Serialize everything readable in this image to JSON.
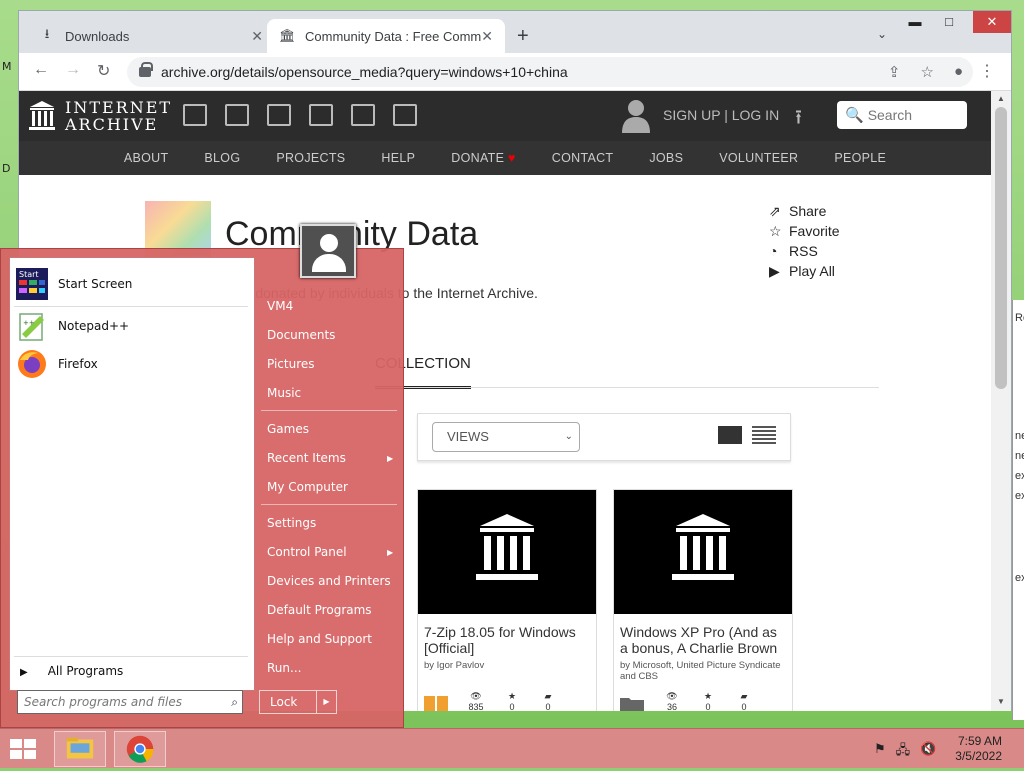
{
  "browser": {
    "tabs": [
      {
        "label": "Downloads",
        "icon": "download-icon",
        "active": false
      },
      {
        "label": "Community Data : Free Commun",
        "icon": "archive-icon",
        "active": true
      }
    ],
    "url": "archive.org/details/opensource_media?query=windows+10+china"
  },
  "ia": {
    "logo_line1": "INTERNET",
    "logo_line2": "ARCHIVE",
    "signup": "SIGN UP | LOG IN",
    "search_placeholder": "Search",
    "nav": [
      "ABOUT",
      "BLOG",
      "PROJECTS",
      "HELP",
      "DONATE",
      "CONTACT",
      "JOBS",
      "VOLUNTEER",
      "PEOPLE"
    ]
  },
  "collection": {
    "title": "Community Data",
    "description": "edia donated by individuals to the Internet Archive.",
    "actions": [
      "Share",
      "Favorite",
      "RSS",
      "Play All"
    ],
    "tab": "COLLECTION",
    "views_label": "VIEWS"
  },
  "cards": [
    {
      "title": "7-Zip 18.05 for Windows [Official]",
      "by": "by Igor Pavlov",
      "views": "835",
      "favs": "0",
      "reviews": "0",
      "type": "book"
    },
    {
      "title": "Windows XP Pro (And as a bonus, A Charlie Brown",
      "by": "by Microsoft, United Picture Syndicate and CBS",
      "views": "36",
      "favs": "0",
      "reviews": "0",
      "type": "folder"
    }
  ],
  "startmenu": {
    "pinned": [
      {
        "label": "Start Screen",
        "icon": "start-screen-icon"
      },
      {
        "label": "Notepad++",
        "icon": "notepadpp-icon"
      },
      {
        "label": "Firefox",
        "icon": "firefox-icon"
      }
    ],
    "all_programs": "All Programs",
    "search_placeholder": "Search programs and files",
    "right_items": [
      "VM4",
      "Documents",
      "Pictures",
      "Music",
      "Games",
      "Recent Items",
      "My Computer",
      "Settings",
      "Control Panel",
      "Devices and Printers",
      "Default Programs",
      "Help and Support",
      "Run..."
    ],
    "lock_label": "Lock"
  },
  "taskbar": {
    "time": "7:59 AM",
    "date": "3/5/2022"
  },
  "colors": {
    "startmenu": "#d76464",
    "ia_header": "#2c2c2c",
    "taskbar": "#d98a88"
  }
}
